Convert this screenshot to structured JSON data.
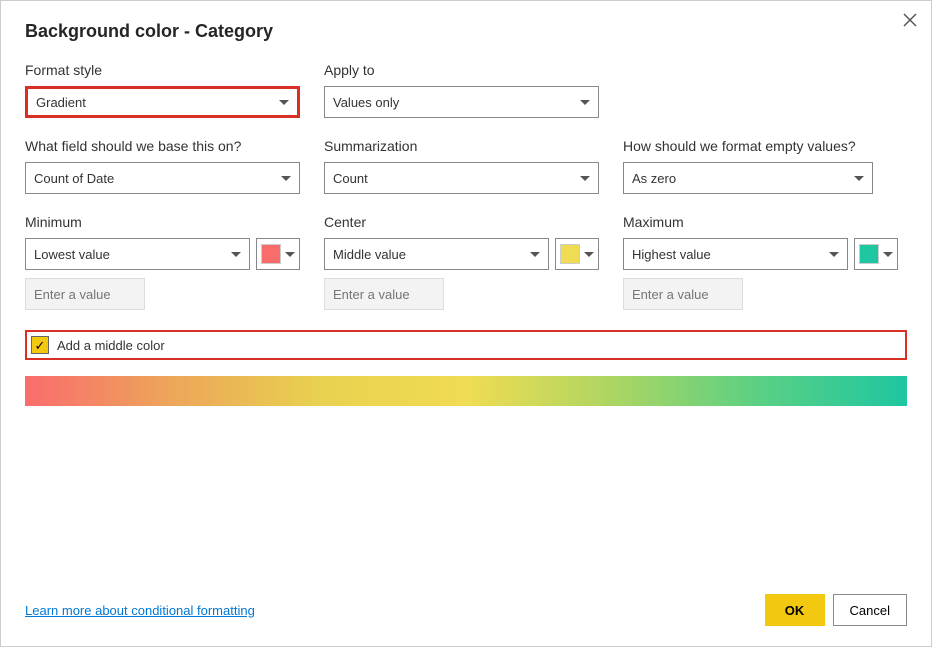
{
  "dialog": {
    "title": "Background color - Category"
  },
  "formatStyle": {
    "label": "Format style",
    "value": "Gradient"
  },
  "applyTo": {
    "label": "Apply to",
    "value": "Values only"
  },
  "baseField": {
    "label": "What field should we base this on?",
    "value": "Count of Date"
  },
  "summarization": {
    "label": "Summarization",
    "value": "Count"
  },
  "emptyValues": {
    "label": "How should we format empty values?",
    "value": "As zero"
  },
  "minimum": {
    "label": "Minimum",
    "value": "Lowest value",
    "color": "#f96c6c",
    "placeholder": "Enter a value"
  },
  "center": {
    "label": "Center",
    "value": "Middle value",
    "color": "#f0dc52",
    "placeholder": "Enter a value"
  },
  "maximum": {
    "label": "Maximum",
    "value": "Highest value",
    "color": "#1ec6a1",
    "placeholder": "Enter a value"
  },
  "middleColor": {
    "label": "Add a middle color",
    "checked": true
  },
  "footer": {
    "learnMore": "Learn more about conditional formatting",
    "ok": "OK",
    "cancel": "Cancel"
  }
}
